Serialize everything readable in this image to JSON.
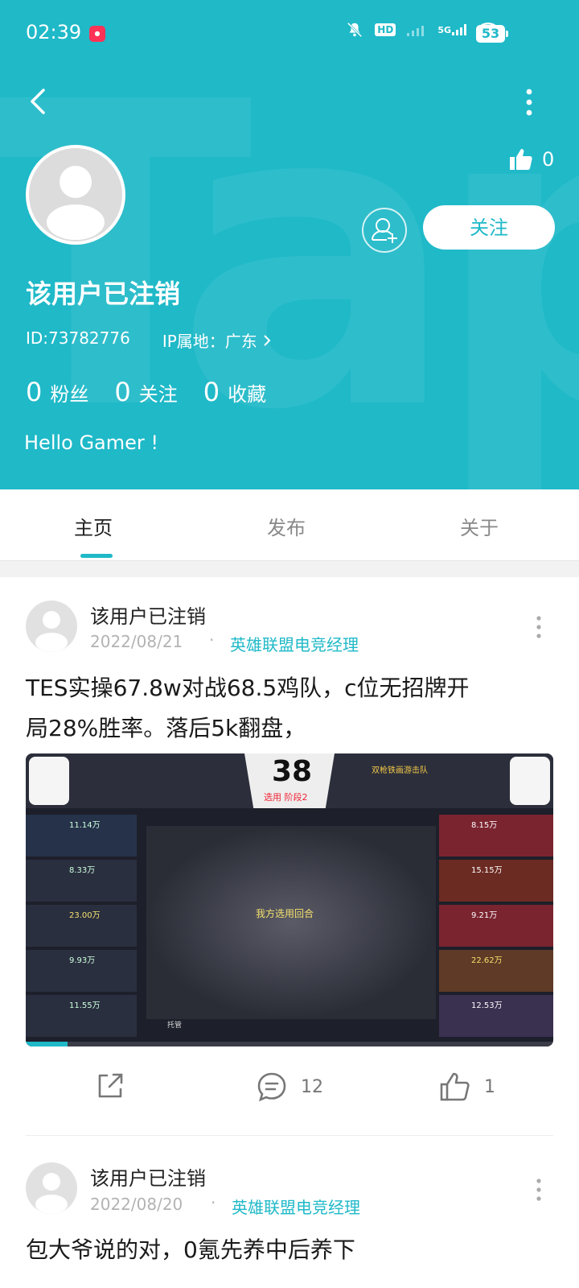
{
  "status_bar": {
    "time": "02:39",
    "battery": "53",
    "signal_label": "5G",
    "hd_label": "HD"
  },
  "profile": {
    "username": "该用户已注销",
    "id_text": "ID:73782776",
    "ip_label": "IP属地：广东",
    "likes": "0",
    "follow_label": "关注",
    "bio": "Hello Gamer !",
    "stats": [
      {
        "num": "0",
        "label": "粉丝"
      },
      {
        "num": "0",
        "label": "关注"
      },
      {
        "num": "0",
        "label": "收藏"
      }
    ]
  },
  "tabs": [
    {
      "label": "主页",
      "active": true
    },
    {
      "label": "发布",
      "active": false
    },
    {
      "label": "关于",
      "active": false
    }
  ],
  "posts": [
    {
      "user": "该用户已注销",
      "date": "2022/08/21",
      "dot": "·",
      "category": "英雄联盟电竞经理",
      "text_line1": "TES实操67.8w对战68.5鸡队，c位无招牌开",
      "text_line2": "局28%胜率。落后5k翻盘，",
      "media": {
        "round_number": "38",
        "phase": "选用 阶段2",
        "center_label": "我方选用回合",
        "right_team": "双枪铁画游击队",
        "left_values": [
          "11.14万",
          "8.33万",
          "23.00万",
          "9.93万",
          "11.55万"
        ],
        "right_values": [
          "8.15万",
          "15.15万",
          "9.21万",
          "22.62万",
          "12.53万"
        ],
        "seat_label": "托管"
      },
      "comments": "12",
      "likes": "1"
    },
    {
      "user": "该用户已注销",
      "date": "2022/08/20",
      "dot": "·",
      "category": "英雄联盟电竞经理",
      "text_line1": "包大爷说的对，0氪先养中后养下"
    }
  ]
}
